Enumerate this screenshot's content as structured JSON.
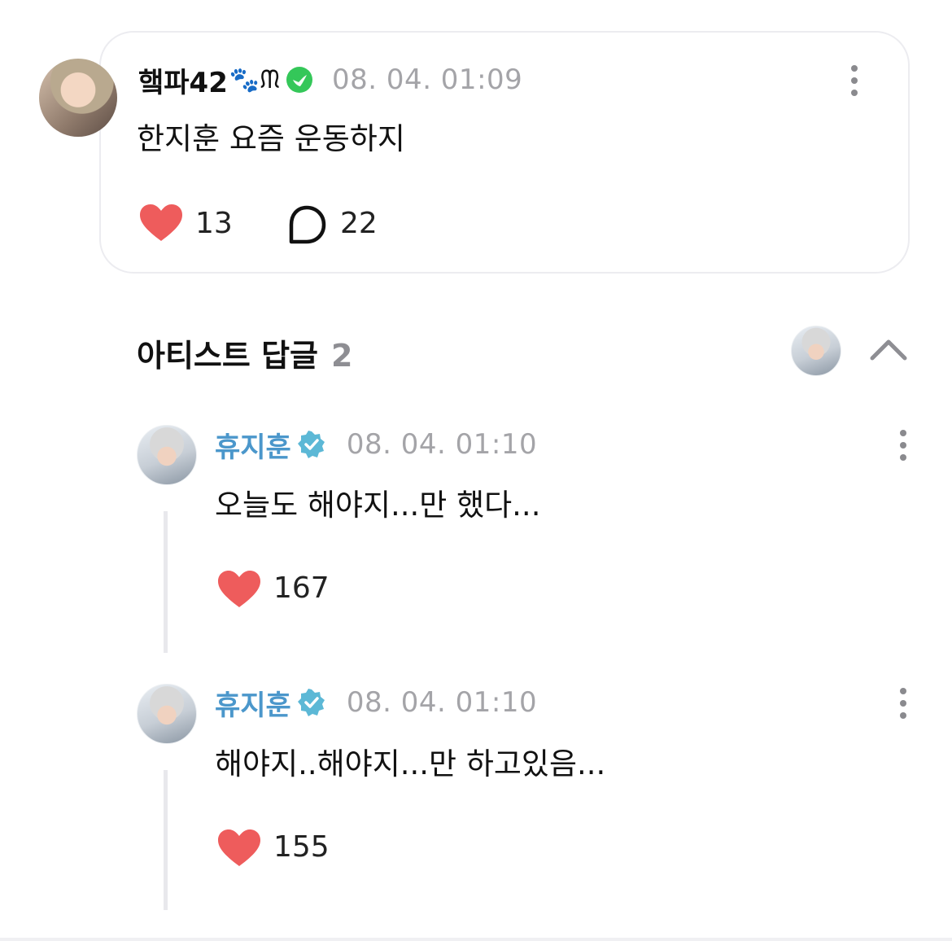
{
  "post": {
    "username": "햌파42",
    "badge_emoji": "🐾ᙏ",
    "timestamp": "08. 04. 01:09",
    "text": "한지훈 요즘 운동하지",
    "likes": "13",
    "comments": "22"
  },
  "artist_section": {
    "title": "아티스트 답글",
    "count": "2"
  },
  "replies": [
    {
      "name": "휴지훈",
      "timestamp": "08. 04. 01:10",
      "text": "오늘도 해야지...만 했다...",
      "likes": "167"
    },
    {
      "name": "휴지훈",
      "timestamp": "08. 04. 01:10",
      "text": "해야지..해야지...만 하고있음...",
      "likes": "155"
    }
  ],
  "colors": {
    "heart": "#ee5c5c",
    "artist_name": "#4b97cb",
    "verified_badge": "#5cb8d6",
    "fan_badge": "#34c759"
  },
  "icons": [
    "more-icon",
    "heart-icon",
    "comment-bubble-icon",
    "chevron-up-icon",
    "verified-badge-icon"
  ]
}
